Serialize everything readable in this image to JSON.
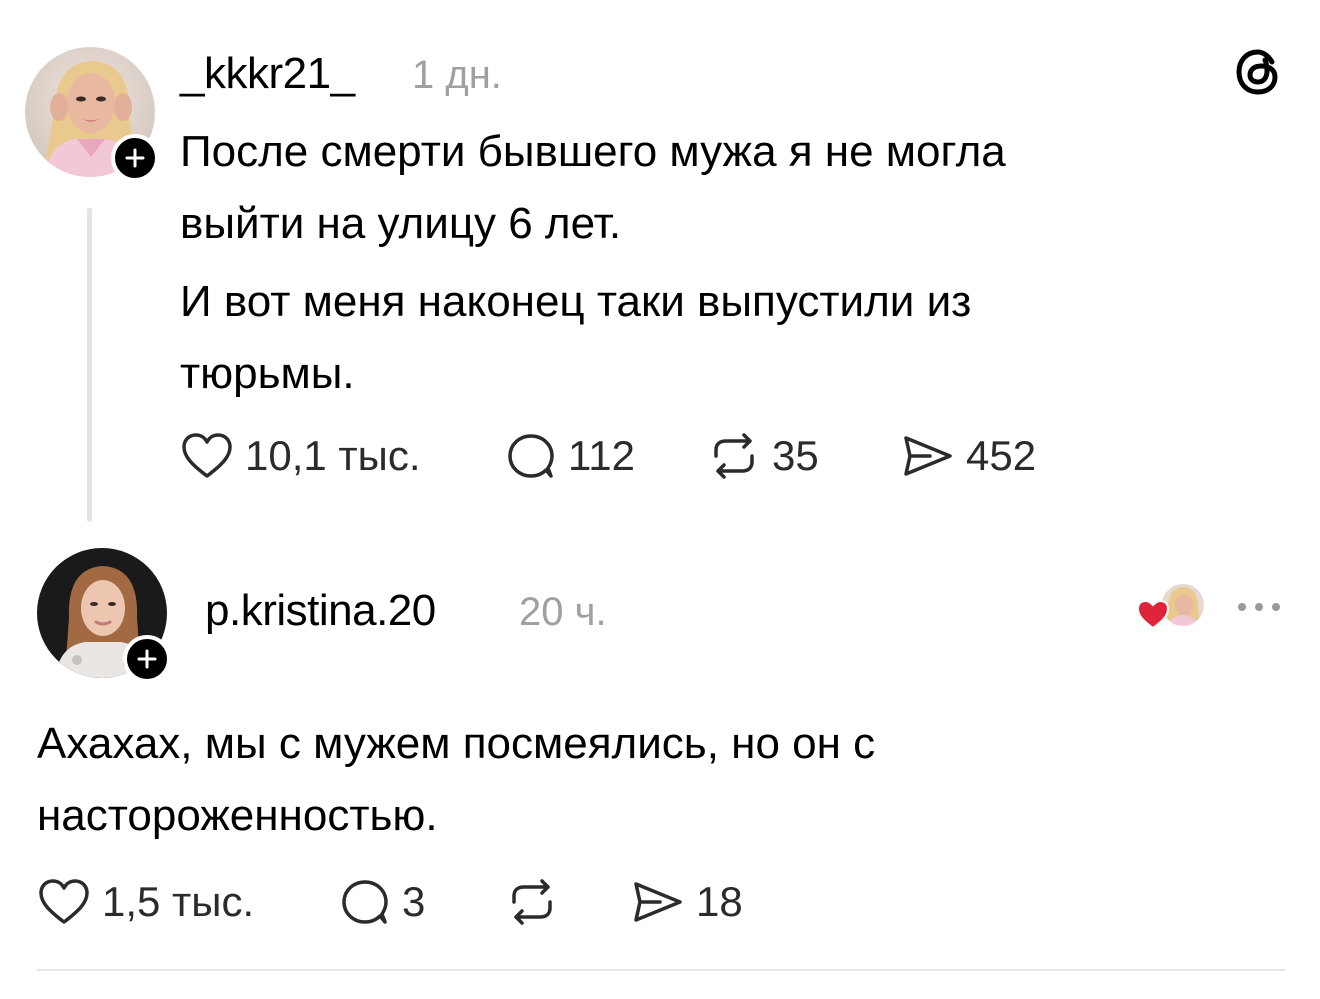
{
  "app_icon": "threads-logo-icon",
  "post": {
    "username": "_kkkr21_",
    "time": "1 дн.",
    "paragraphs": [
      [
        "После смерти бывшего мужа я не могла",
        "выйти на улицу 6 лет."
      ],
      [
        "И вот меня наконец таки выпустили из",
        "тюрьмы."
      ]
    ],
    "stats": {
      "likes": "10,1 тыс.",
      "replies": "112",
      "reposts": "35",
      "shares": "452"
    }
  },
  "reply": {
    "username": "p.kristina.20",
    "time": "20 ч.",
    "liked_by_author_icon": "heart-icon",
    "lines": [
      "Ахахах, мы с мужем посмеялись, но он с",
      "настороженностью."
    ],
    "stats": {
      "likes": "1,5 тыс.",
      "replies": "3",
      "shares": "18"
    }
  },
  "colors": {
    "text": "#000000",
    "muted": "#a0a0a0",
    "thread_line": "#e4e4e4",
    "heart": "#e0243a"
  }
}
